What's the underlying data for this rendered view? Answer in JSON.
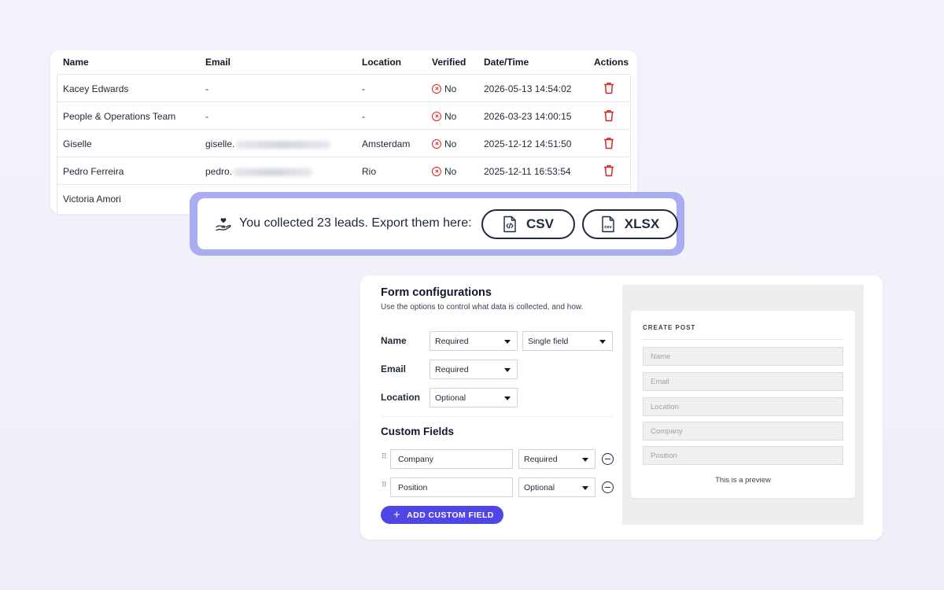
{
  "table": {
    "headers": {
      "name": "Name",
      "email": "Email",
      "location": "Location",
      "verified": "Verified",
      "datetime": "Date/Time",
      "actions": "Actions"
    },
    "rows": [
      {
        "name": "Kacey Edwards",
        "email": "-",
        "location": "-",
        "verified": "No",
        "datetime": "2026-05-13 14:54:02"
      },
      {
        "name": "People & Operations Team",
        "email": "-",
        "location": "-",
        "verified": "No",
        "datetime": "2026-03-23 14:00:15"
      },
      {
        "name": "Giselle",
        "email": "giselle.",
        "location": "Amsterdam",
        "verified": "No",
        "datetime": "2025-12-12 14:51:50"
      },
      {
        "name": "Pedro Ferreira",
        "email": "pedro.",
        "location": "Rio",
        "verified": "No",
        "datetime": "2025-12-11 16:53:54"
      },
      {
        "name": "Victoria Amori",
        "email": "",
        "location": "",
        "verified": "",
        "datetime": ""
      }
    ]
  },
  "export": {
    "message": "You collected 23 leads. Export them here:",
    "csv_label": "CSV",
    "xlsx_label": "XLSX"
  },
  "form": {
    "title": "Form configurations",
    "subtitle": "Use the options to control what data is collected, and how.",
    "fields": {
      "name": {
        "label": "Name",
        "requirement": "Required",
        "mode": "Single field"
      },
      "email": {
        "label": "Email",
        "requirement": "Required"
      },
      "location": {
        "label": "Location",
        "requirement": "Optional"
      }
    },
    "custom_title": "Custom Fields",
    "custom_fields": [
      {
        "value": "Company",
        "requirement": "Required"
      },
      {
        "value": "Position",
        "requirement": "Optional"
      }
    ],
    "add_button": "ADD CUSTOM FIELD"
  },
  "preview": {
    "title": "CREATE POST",
    "placeholders": [
      "Name",
      "Email",
      "Location",
      "Company",
      "Position"
    ],
    "note": "This is a preview"
  },
  "colors": {
    "accent": "#4f46e5",
    "export_frame": "#a9acf0",
    "danger": "#dc2626"
  }
}
